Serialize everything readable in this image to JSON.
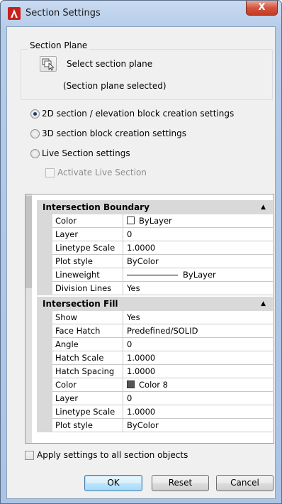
{
  "window": {
    "title": "Section Settings",
    "close_label": "X",
    "app_icon": "autocad-logo-icon",
    "accent_color": "#c8211b"
  },
  "section_plane": {
    "group_title": "Section Plane",
    "select_label": "Select section plane",
    "select_icon": "select-plane-icon",
    "status": "(Section plane selected)"
  },
  "options": [
    {
      "label": "2D section / elevation block creation settings",
      "selected": true
    },
    {
      "label": "3D section block creation settings",
      "selected": false
    },
    {
      "label": "Live Section settings",
      "selected": false
    }
  ],
  "activate_live": {
    "label": "Activate Live Section",
    "checked": false,
    "enabled": false
  },
  "grid": {
    "sections": [
      {
        "title": "Intersection Boundary",
        "rows": [
          {
            "name": "Color",
            "value": "ByLayer"
          },
          {
            "name": "Layer",
            "value": "0"
          },
          {
            "name": "Linetype Scale",
            "value": "1.0000"
          },
          {
            "name": "Plot style",
            "value": "ByColor"
          },
          {
            "name": "Lineweight",
            "value": "ByLayer"
          },
          {
            "name": "Division Lines",
            "value": "Yes"
          }
        ]
      },
      {
        "title": "Intersection Fill",
        "rows": [
          {
            "name": "Show",
            "value": "Yes"
          },
          {
            "name": "Face Hatch",
            "value": "Predefined/SOLID"
          },
          {
            "name": "Angle",
            "value": "0"
          },
          {
            "name": "Hatch Scale",
            "value": "1.0000"
          },
          {
            "name": "Hatch Spacing",
            "value": "1.0000"
          },
          {
            "name": "Color",
            "value": "Color 8"
          },
          {
            "name": "Layer",
            "value": "0"
          },
          {
            "name": "Linetype Scale",
            "value": "1.0000"
          },
          {
            "name": "Plot style",
            "value": "ByColor"
          }
        ]
      }
    ]
  },
  "apply_all": {
    "label": "Apply settings to all section objects",
    "checked": false
  },
  "buttons": {
    "ok": "OK",
    "reset": "Reset",
    "cancel": "Cancel"
  }
}
